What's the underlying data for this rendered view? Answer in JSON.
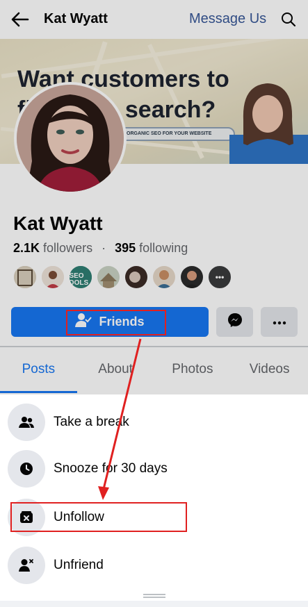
{
  "header": {
    "title": "Kat Wyatt",
    "message_link": "Message Us"
  },
  "cover": {
    "headline_line1": "Want customers to",
    "headline_line2": "fi          in search?",
    "subline": "ORGANIC SEO FOR YOUR WEBSITE"
  },
  "profile": {
    "name": "Kat Wyatt",
    "followers_count": "2.1K",
    "followers_label": "followers",
    "separator": "·",
    "following_count": "395",
    "following_label": "following",
    "friend_thumbs": [
      {
        "icon": "friend-thumb-1"
      },
      {
        "icon": "friend-thumb-2"
      },
      {
        "icon": "friend-thumb-3",
        "text": "SEO TOOLS"
      },
      {
        "icon": "friend-thumb-4"
      },
      {
        "icon": "friend-thumb-5"
      },
      {
        "icon": "friend-thumb-6"
      },
      {
        "icon": "friend-thumb-7"
      },
      {
        "icon": "more-friends-icon",
        "text": "•••"
      }
    ]
  },
  "actions": {
    "friends_label": "Friends"
  },
  "tabs": [
    {
      "label": "Posts",
      "active": true
    },
    {
      "label": "About",
      "active": false
    },
    {
      "label": "Photos",
      "active": false
    },
    {
      "label": "Videos",
      "active": false
    }
  ],
  "sheet": {
    "items": [
      {
        "label": "Take a break",
        "icon": "people-icon"
      },
      {
        "label": "Snooze for 30 days",
        "icon": "clock-icon"
      },
      {
        "label": "Unfollow",
        "icon": "unfollow-box-icon"
      },
      {
        "label": "Unfriend",
        "icon": "remove-person-icon"
      }
    ]
  },
  "colors": {
    "accent": "#1877f2",
    "link": "#385898",
    "annotation": "#e02020",
    "sheet_icon_bg": "#e4e6eb"
  }
}
